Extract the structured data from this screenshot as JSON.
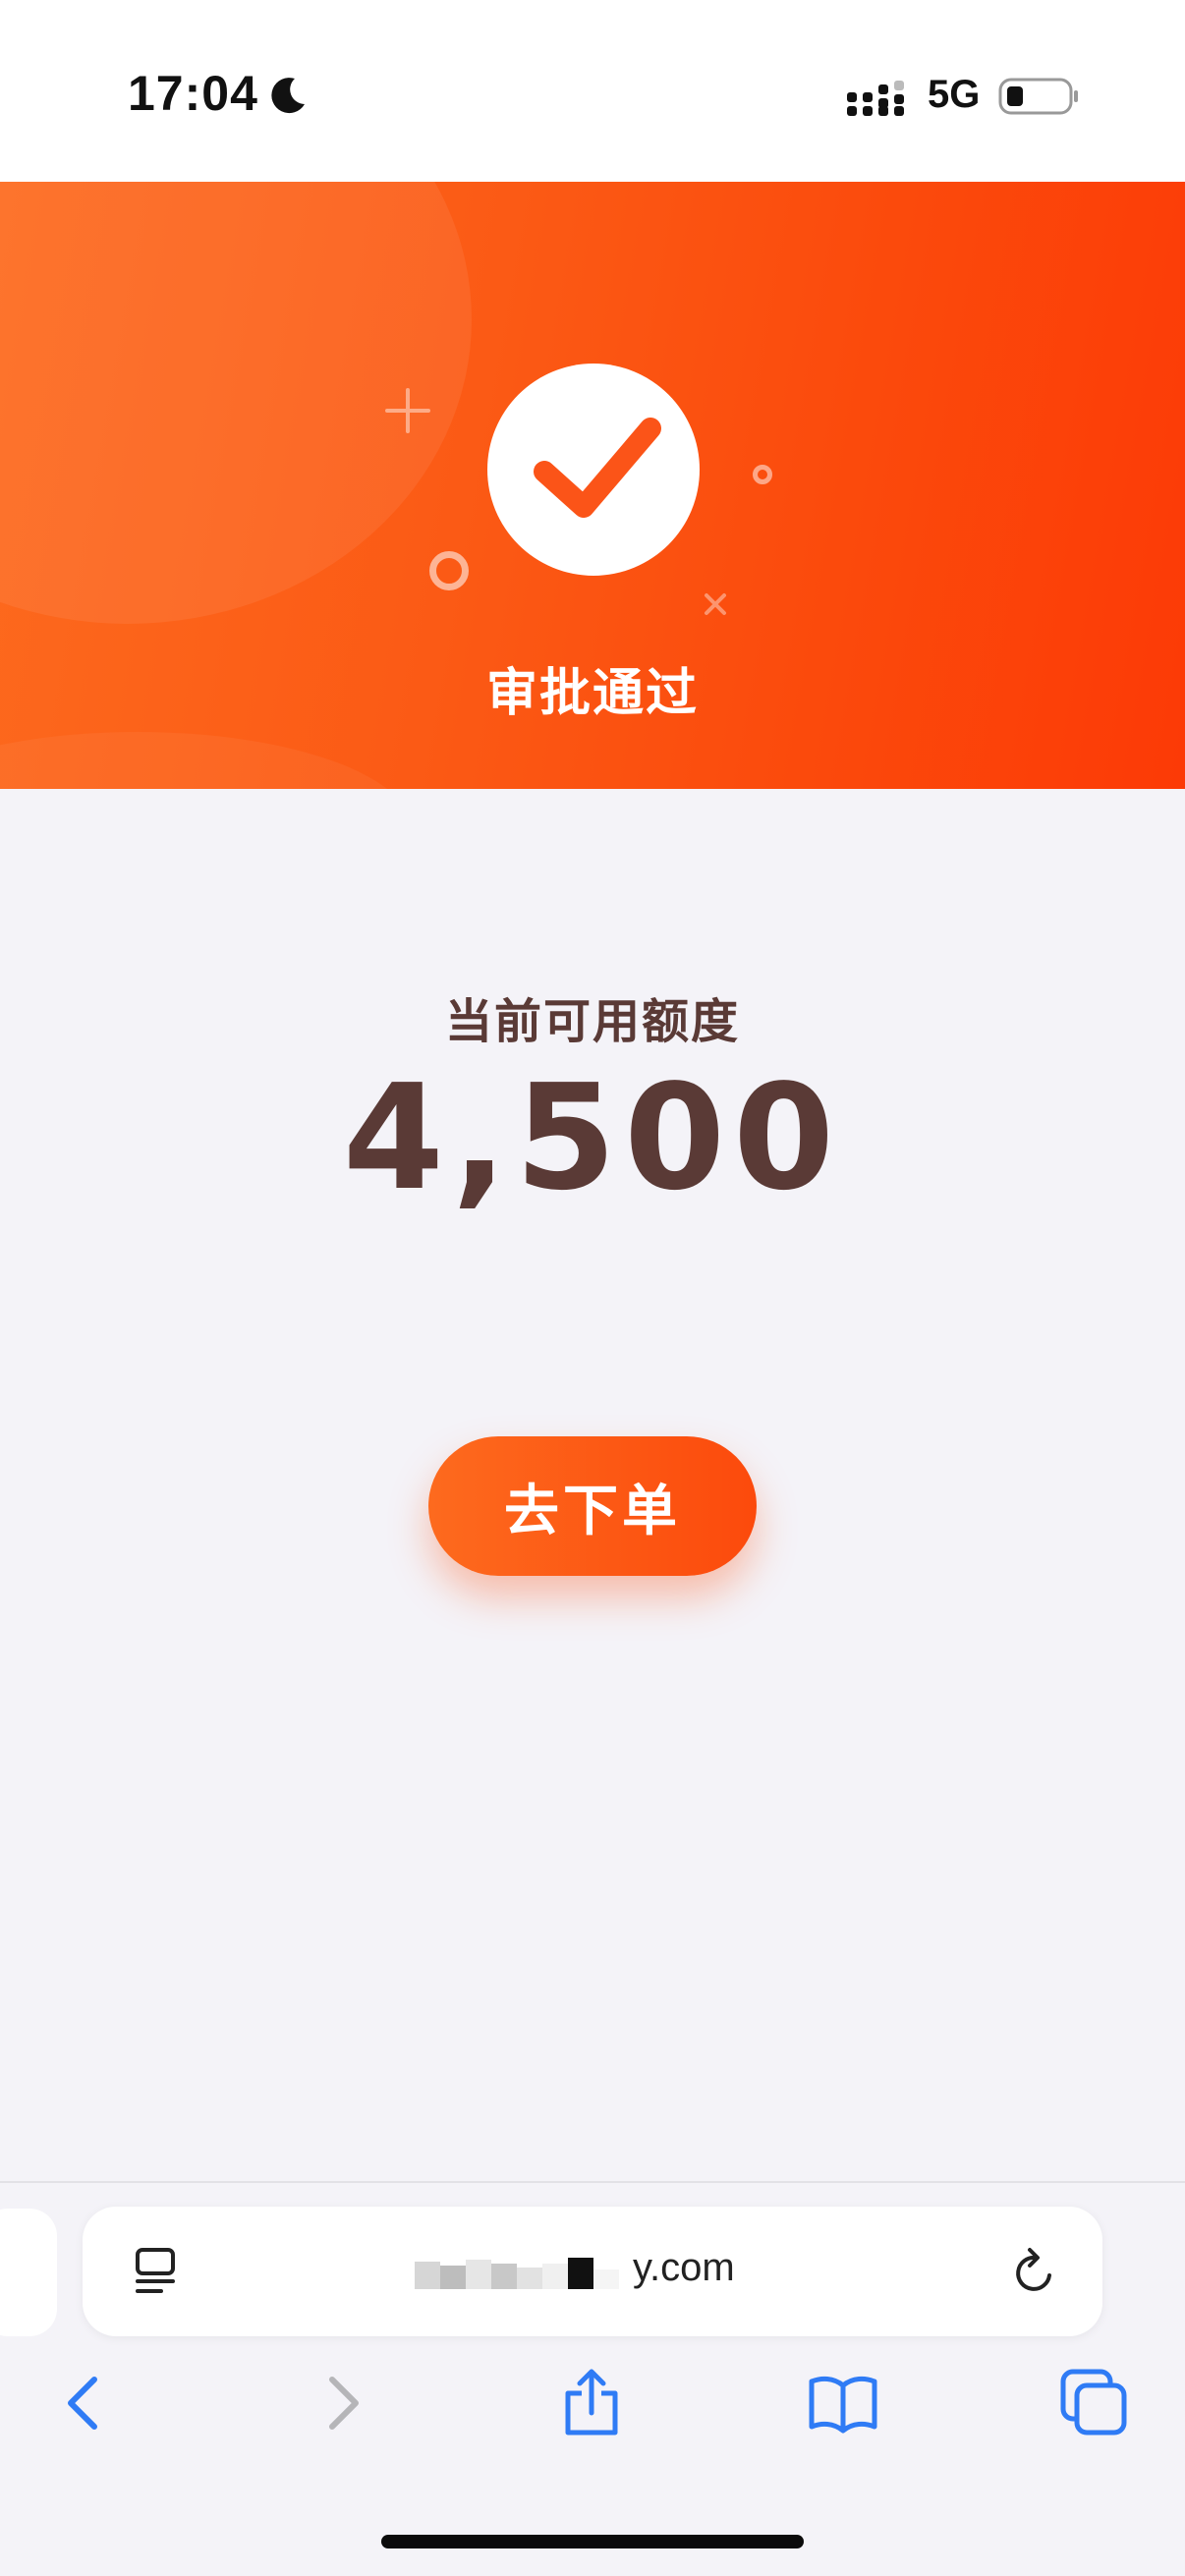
{
  "status_bar": {
    "time": "17:04",
    "network": "5G",
    "icons": [
      "moon-icon",
      "signal-icon",
      "battery-icon"
    ]
  },
  "hero": {
    "title": "审批通过",
    "icon": "check-icon",
    "colors": {
      "gradient_start": "#fd6a1e",
      "gradient_end": "#fc3a06"
    }
  },
  "credit": {
    "label": "当前可用额度",
    "amount": "4,500",
    "color": "#5a3a36"
  },
  "order_button": {
    "label": "去下单"
  },
  "browser": {
    "url_visible": "y.com",
    "icons": {
      "reader": "reader-icon",
      "reload": "reload-icon",
      "back": "chevron-left-icon",
      "forward": "chevron-right-icon",
      "share": "share-icon",
      "bookmarks": "book-icon",
      "tabs": "tabs-icon"
    },
    "accent": "#2f7bf5"
  }
}
